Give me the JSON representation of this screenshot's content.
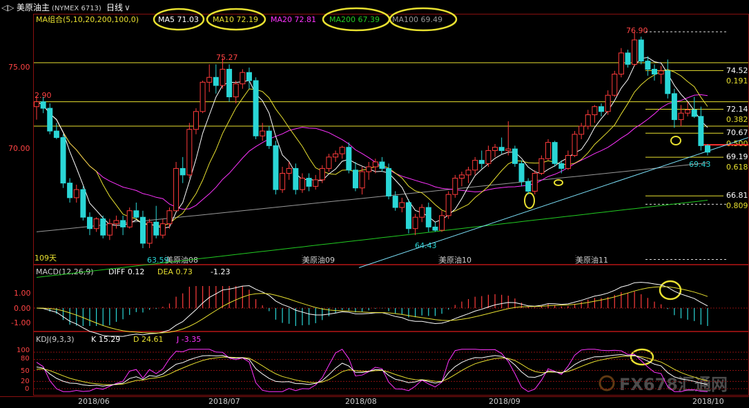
{
  "title_bar": {
    "back_label": "◁▷",
    "instrument": "美原油主",
    "code": "(NYMEX 6713)",
    "period": "日线",
    "period_arrow": "∨"
  },
  "ma_legend": {
    "group": "MA组合(5,10,20,200,100,0)",
    "items": [
      {
        "label": "MA5 71.03",
        "color": "#ffffff",
        "circled": true
      },
      {
        "label": "MA10 72.19",
        "color": "#e8e030",
        "circled": true
      },
      {
        "label": "MA20 72.81",
        "color": "#ff33ff",
        "circled": false
      },
      {
        "label": "MA200 67.39",
        "color": "#22cc22",
        "circled": true
      },
      {
        "label": "MA100 69.49",
        "color": "#999999",
        "circled": true
      }
    ]
  },
  "price_panel": {
    "y_ticks": [
      {
        "value": 75.0,
        "label": "75.00"
      },
      {
        "value": 70.0,
        "label": "70.00"
      }
    ],
    "days_label": "109天",
    "month_markers": [
      "美原油08",
      "美原油09",
      "美原油10",
      "美原油11"
    ],
    "annotations": [
      {
        "text": "2.90",
        "color": "#ff4444"
      },
      {
        "text": "75.27",
        "color": "#ff4444"
      },
      {
        "text": "76.90",
        "color": "#ff4444"
      },
      {
        "text": "63.59",
        "color": "#2ad6d6"
      },
      {
        "text": "64.43",
        "color": "#2ad6d6"
      },
      {
        "text": "69.43",
        "color": "#2ad6d6"
      }
    ],
    "fib_levels": [
      {
        "price": "74.52",
        "ratio": "0.191"
      },
      {
        "price": "72.14",
        "ratio": "0.382"
      },
      {
        "price": "70.67",
        "ratio": "0.500"
      },
      {
        "price": "69.19",
        "ratio": "0.618"
      },
      {
        "price": "66.81",
        "ratio": "0.809"
      }
    ]
  },
  "macd_panel": {
    "title": "MACD(12,26,9)",
    "diff": "DIFF 0.12",
    "dea": "DEA 0.73",
    "macd": "-1.23",
    "y_ticks": [
      "1.00",
      "0.00",
      "-1.00"
    ]
  },
  "kdj_panel": {
    "title": "KDJ(9,3,3)",
    "k": "K 15.29",
    "d": "D 24.61",
    "j": "J -3.35",
    "y_ticks": [
      "100",
      "80",
      "50",
      "20",
      "0"
    ]
  },
  "x_axis": [
    "2018/06",
    "2018/07",
    "2018/08",
    "2018/09",
    "2018/10"
  ],
  "watermark": "FX678汇通网",
  "colors": {
    "up": "#ff3b3b",
    "down": "#2ad6d6",
    "ma5": "#ffffff",
    "ma10": "#e8e030",
    "ma20": "#ff33ff",
    "ma200": "#22cc22",
    "ma100": "#999999",
    "highlight": "#e8e030"
  },
  "chart_data": {
    "type": "candlestick",
    "instrument": "美原油主",
    "period": "日线",
    "x_range": [
      "2018-05-22",
      "2018-10-24"
    ],
    "ylim": [
      62.5,
      77.5
    ],
    "candles_ohlc": [
      [
        72.3,
        72.9,
        71.5,
        72.6
      ],
      [
        72.6,
        72.9,
        71.9,
        72.2
      ],
      [
        72.2,
        72.5,
        70.6,
        70.8
      ],
      [
        70.8,
        71.3,
        70.3,
        70.4
      ],
      [
        70.4,
        70.6,
        67.3,
        67.6
      ],
      [
        67.6,
        67.9,
        66.4,
        66.7
      ],
      [
        66.7,
        67.5,
        66.4,
        67.2
      ],
      [
        67.2,
        67.4,
        65.3,
        65.5
      ],
      [
        65.5,
        65.8,
        64.4,
        64.8
      ],
      [
        64.8,
        65.5,
        64.6,
        65.4
      ],
      [
        65.4,
        65.6,
        64.2,
        64.4
      ],
      [
        64.4,
        65.4,
        64.1,
        65.1
      ],
      [
        65.1,
        65.6,
        64.8,
        65.3
      ],
      [
        65.3,
        65.6,
        64.4,
        64.9
      ],
      [
        64.9,
        66.1,
        64.8,
        65.9
      ],
      [
        65.9,
        66.4,
        65.4,
        65.5
      ],
      [
        65.5,
        65.9,
        63.6,
        63.9
      ],
      [
        63.9,
        65.4,
        63.6,
        65.2
      ],
      [
        65.2,
        66.2,
        64.2,
        64.4
      ],
      [
        64.4,
        65.4,
        64.2,
        65.1
      ],
      [
        65.1,
        66.1,
        64.8,
        65.9
      ],
      [
        65.9,
        68.9,
        65.9,
        68.5
      ],
      [
        68.5,
        69.2,
        67.6,
        68.1
      ],
      [
        68.1,
        71.3,
        67.9,
        70.9
      ],
      [
        70.9,
        72.2,
        70.6,
        72.0
      ],
      [
        72.0,
        73.9,
        71.9,
        73.8
      ],
      [
        73.8,
        74.9,
        73.2,
        74.1
      ],
      [
        74.1,
        74.9,
        73.1,
        73.6
      ],
      [
        73.6,
        75.3,
        73.4,
        74.6
      ],
      [
        74.6,
        74.9,
        72.6,
        72.9
      ],
      [
        72.9,
        73.9,
        72.5,
        73.7
      ],
      [
        73.7,
        74.6,
        73.4,
        74.4
      ],
      [
        74.4,
        74.7,
        73.4,
        73.9
      ],
      [
        73.9,
        74.1,
        70.3,
        70.5
      ],
      [
        70.5,
        71.3,
        70.2,
        70.8
      ],
      [
        70.8,
        71.1,
        69.7,
        69.9
      ],
      [
        69.9,
        70.2,
        66.9,
        67.2
      ],
      [
        67.2,
        68.6,
        67.0,
        68.2
      ],
      [
        68.2,
        68.9,
        67.8,
        68.5
      ],
      [
        68.5,
        68.8,
        66.9,
        67.2
      ],
      [
        67.2,
        68.2,
        67.0,
        67.9
      ],
      [
        67.9,
        68.2,
        67.1,
        67.4
      ],
      [
        67.4,
        68.1,
        67.2,
        67.8
      ],
      [
        67.8,
        68.7,
        67.6,
        68.5
      ],
      [
        68.5,
        69.4,
        68.3,
        69.2
      ],
      [
        69.2,
        69.6,
        68.9,
        69.4
      ],
      [
        69.4,
        69.9,
        69.1,
        69.8
      ],
      [
        69.8,
        70.1,
        68.2,
        68.4
      ],
      [
        68.4,
        68.9,
        67.1,
        67.3
      ],
      [
        67.3,
        68.6,
        66.9,
        68.3
      ],
      [
        68.3,
        68.9,
        67.8,
        68.6
      ],
      [
        68.6,
        69.1,
        68.2,
        68.9
      ],
      [
        68.9,
        69.2,
        68.3,
        68.5
      ],
      [
        68.5,
        68.8,
        66.6,
        66.8
      ],
      [
        66.8,
        67.1,
        65.9,
        66.1
      ],
      [
        66.1,
        66.7,
        65.8,
        66.4
      ],
      [
        66.4,
        66.6,
        64.5,
        64.8
      ],
      [
        64.8,
        65.7,
        64.4,
        65.5
      ],
      [
        65.5,
        66.3,
        65.2,
        66.1
      ],
      [
        66.1,
        66.4,
        64.6,
        64.9
      ],
      [
        64.9,
        65.2,
        64.6,
        64.7
      ],
      [
        64.7,
        65.9,
        64.6,
        65.6
      ],
      [
        65.6,
        67.1,
        65.4,
        66.9
      ],
      [
        66.9,
        68.1,
        66.7,
        67.9
      ],
      [
        67.9,
        68.3,
        67.4,
        68.1
      ],
      [
        68.1,
        68.6,
        67.6,
        68.4
      ],
      [
        68.4,
        69.2,
        68.1,
        69.0
      ],
      [
        69.0,
        69.6,
        68.5,
        68.8
      ],
      [
        68.8,
        69.9,
        68.6,
        69.6
      ],
      [
        69.6,
        70.0,
        69.2,
        69.8
      ],
      [
        69.8,
        70.4,
        69.4,
        69.6
      ],
      [
        69.6,
        71.4,
        69.3,
        69.7
      ],
      [
        69.7,
        69.9,
        68.6,
        68.8
      ],
      [
        68.8,
        69.0,
        67.4,
        67.7
      ],
      [
        67.7,
        67.9,
        66.9,
        67.1
      ],
      [
        67.1,
        68.4,
        66.9,
        68.2
      ],
      [
        68.2,
        69.3,
        68.1,
        69.1
      ],
      [
        69.1,
        70.3,
        69.0,
        70.1
      ],
      [
        70.1,
        70.2,
        68.6,
        68.8
      ],
      [
        68.8,
        69.0,
        68.2,
        68.5
      ],
      [
        68.5,
        69.6,
        68.4,
        69.3
      ],
      [
        69.3,
        70.8,
        69.2,
        70.6
      ],
      [
        70.6,
        71.3,
        70.3,
        71.1
      ],
      [
        71.1,
        72.1,
        70.9,
        71.8
      ],
      [
        71.8,
        72.4,
        71.3,
        72.3
      ],
      [
        72.3,
        72.5,
        71.7,
        72.0
      ],
      [
        72.0,
        73.3,
        71.8,
        73.0
      ],
      [
        73.0,
        74.5,
        72.9,
        74.3
      ],
      [
        74.3,
        75.9,
        74.1,
        75.6
      ],
      [
        75.6,
        75.8,
        74.7,
        74.9
      ],
      [
        74.9,
        76.9,
        74.8,
        76.4
      ],
      [
        76.4,
        76.6,
        74.9,
        75.1
      ],
      [
        75.1,
        75.4,
        74.2,
        74.6
      ],
      [
        74.6,
        74.9,
        73.9,
        74.3
      ],
      [
        74.3,
        74.8,
        73.7,
        74.5
      ],
      [
        74.5,
        75.2,
        72.8,
        73.1
      ],
      [
        73.1,
        73.4,
        71.0,
        71.5
      ],
      [
        71.5,
        72.4,
        71.1,
        71.9
      ],
      [
        71.9,
        72.6,
        71.7,
        72.1
      ],
      [
        72.1,
        72.9,
        71.6,
        71.7
      ],
      [
        71.7,
        72.3,
        69.6,
        69.9
      ],
      [
        69.9,
        70.0,
        69.3,
        69.5
      ]
    ],
    "candle_dates_note": "approx. daily sessions",
    "ma": {
      "MA5": 71.03,
      "MA10": 72.19,
      "MA20": 72.81,
      "MA200": 67.39,
      "MA100": 69.49
    },
    "highs_lows": {
      "high_jul": 75.27,
      "high_oct": 76.9,
      "low_jun": 63.59,
      "low_aug": 64.43,
      "last_low": 69.43
    },
    "fibonacci": [
      {
        "ratio": 0.191,
        "price": 74.52
      },
      {
        "ratio": 0.382,
        "price": 72.14
      },
      {
        "ratio": 0.5,
        "price": 70.67
      },
      {
        "ratio": 0.618,
        "price": 69.19
      },
      {
        "ratio": 0.809,
        "price": 66.81
      }
    ],
    "macd": {
      "DIFF": 0.12,
      "DEA": 0.73,
      "MACD": -1.23,
      "ylim": [
        -1.5,
        2.0
      ]
    },
    "kdj": {
      "K": 15.29,
      "D": 24.61,
      "J": -3.35,
      "ylim": [
        -10,
        110
      ]
    },
    "x_tick_labels": [
      "2018/06",
      "2018/07",
      "2018/08",
      "2018/09",
      "2018/10"
    ]
  }
}
